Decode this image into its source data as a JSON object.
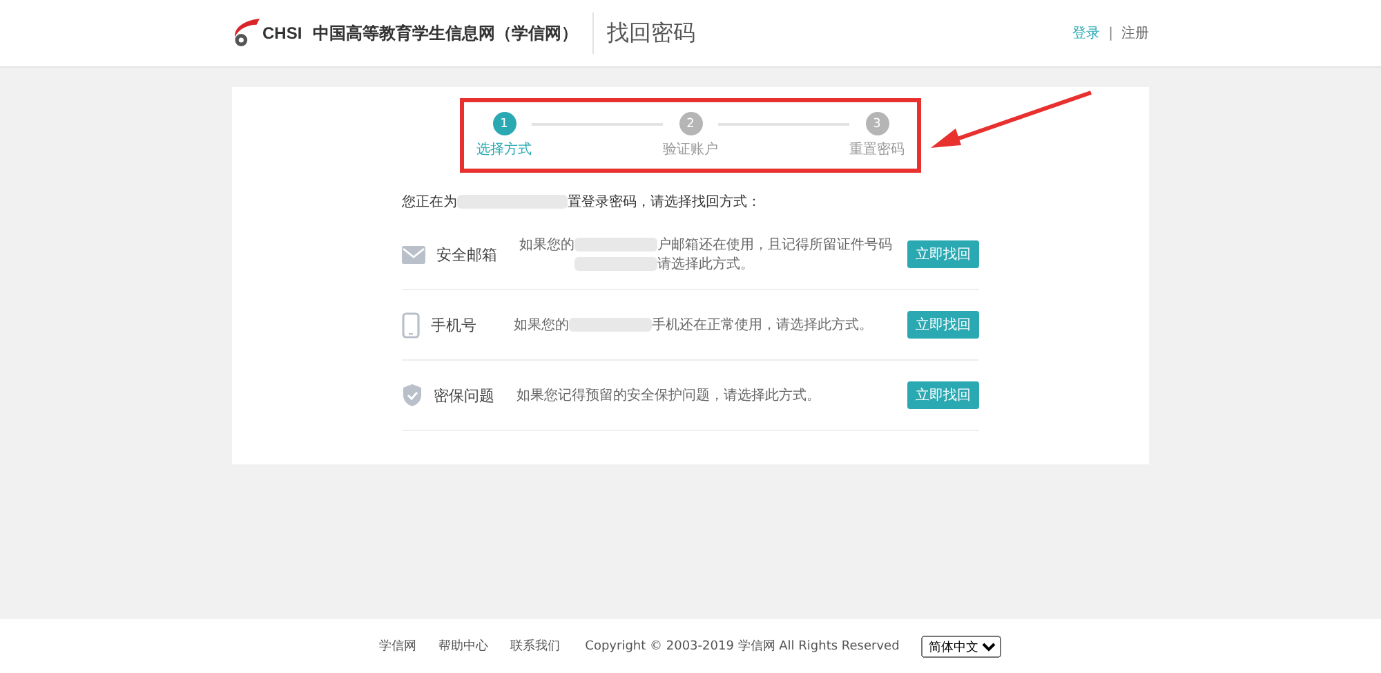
{
  "header": {
    "site_name": "中国高等教育学生信息网（学信网）",
    "logo_text": "CHSI",
    "page_title": "找回密码",
    "links": [
      {
        "label": "登录",
        "selected": true
      },
      {
        "label": "注册",
        "selected": false
      }
    ],
    "separator": "|"
  },
  "steps": [
    {
      "number": "1",
      "label": "选择方式",
      "selected": true
    },
    {
      "number": "2",
      "label": "验证账户",
      "selected": false
    },
    {
      "number": "3",
      "label": "重置密码",
      "selected": false
    }
  ],
  "intro": [
    {
      "kind": "text",
      "text": "您正在为"
    },
    {
      "kind": "redacted"
    },
    {
      "kind": "text",
      "text": "置登录密码，请选择找回方式："
    }
  ],
  "methods": [
    {
      "kind": "email",
      "name": "安全邮箱",
      "lines": [
        [
          {
            "kind": "text",
            "text": "如果您的"
          },
          {
            "kind": "redacted"
          },
          {
            "kind": "text",
            "text": "户邮箱还在使用，且记得所留证件号码"
          }
        ],
        [
          {
            "kind": "redacted"
          },
          {
            "kind": "text",
            "text": "请选择此方式。"
          }
        ]
      ],
      "button": "立即找回"
    },
    {
      "kind": "phone",
      "name": "手机号",
      "lines": [
        [
          {
            "kind": "text",
            "text": "如果您的"
          },
          {
            "kind": "redacted"
          },
          {
            "kind": "text",
            "text": "手机还在正常使用，请选择此方式。"
          }
        ]
      ],
      "button": "立即找回"
    },
    {
      "kind": "shield",
      "name": "密保问题",
      "lines": [
        [
          {
            "kind": "text",
            "text": "如果您记得预留的安全保护问题，请选择此方式。"
          }
        ]
      ],
      "button": "立即找回"
    }
  ],
  "footer": {
    "links": [
      "学信网",
      "帮助中心",
      "联系我们"
    ],
    "copyright": "Copyright © 2003-2019 学信网 All Rights Reserved",
    "language": "简体中文"
  }
}
